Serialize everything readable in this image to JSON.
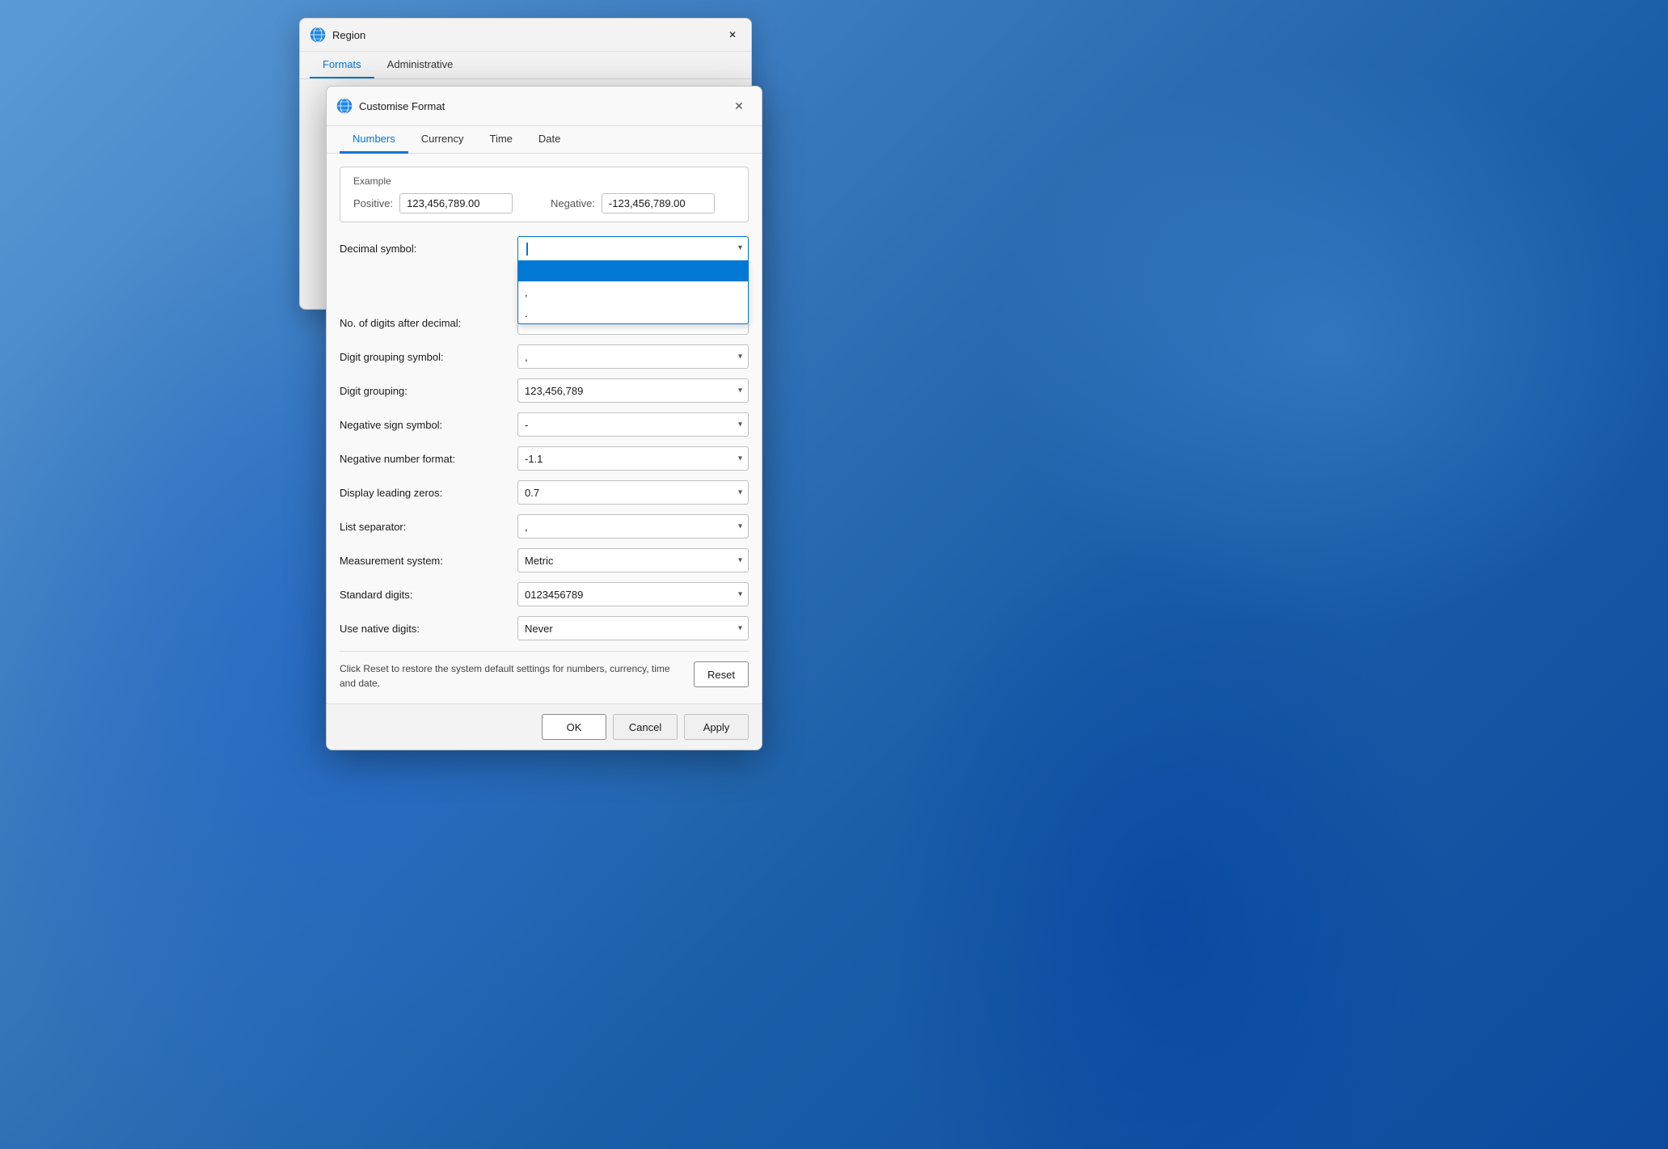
{
  "desktop": {
    "background_description": "Windows 11 blue swirl wallpaper"
  },
  "region_dialog": {
    "title": "Region",
    "tabs": [
      {
        "label": "Formats",
        "active": true
      },
      {
        "label": "Administrative",
        "active": false
      }
    ],
    "close_button": "✕"
  },
  "customise_dialog": {
    "title": "Customise Format",
    "close_button": "✕",
    "tabs": [
      {
        "label": "Numbers",
        "active": true
      },
      {
        "label": "Currency",
        "active": false
      },
      {
        "label": "Time",
        "active": false
      },
      {
        "label": "Date",
        "active": false
      }
    ],
    "example_section": {
      "heading": "Example",
      "positive_label": "Positive:",
      "positive_value": "123,456,789.00",
      "negative_label": "Negative:",
      "negative_value": "-123,456,789.00"
    },
    "form_fields": [
      {
        "label": "Decimal symbol:",
        "value": "",
        "type": "dropdown_open",
        "options": [
          {
            "value": "",
            "label": "",
            "selected": true
          },
          {
            "value": ",",
            "label": ",",
            "selected": false
          },
          {
            "value": ".",
            "label": ".",
            "selected": false
          }
        ]
      },
      {
        "label": "No. of digits after decimal:",
        "value": "",
        "type": "dropdown"
      },
      {
        "label": "Digit grouping symbol:",
        "value": "",
        "type": "dropdown"
      },
      {
        "label": "Digit grouping:",
        "value": "123,456,789",
        "type": "dropdown"
      },
      {
        "label": "Negative sign symbol:",
        "value": "-",
        "type": "dropdown"
      },
      {
        "label": "Negative number format:",
        "value": "-1.1",
        "type": "dropdown"
      },
      {
        "label": "Display leading zeros:",
        "value": "0.7",
        "type": "dropdown"
      },
      {
        "label": "List separator:",
        "value": ",",
        "type": "dropdown"
      },
      {
        "label": "Measurement system:",
        "value": "Metric",
        "type": "dropdown"
      },
      {
        "label": "Standard digits:",
        "value": "0123456789",
        "type": "dropdown"
      },
      {
        "label": "Use native digits:",
        "value": "Never",
        "type": "dropdown"
      }
    ],
    "reset_text": "Click Reset to restore the system default settings for numbers, currency, time and date.",
    "reset_button": "Reset",
    "ok_button": "OK",
    "cancel_button": "Cancel",
    "apply_button": "Apply",
    "decimal_dropdown_options": [
      {
        "label": "",
        "selected": true
      },
      {
        "label": ",",
        "selected": false
      },
      {
        "label": ".",
        "selected": false
      }
    ]
  }
}
